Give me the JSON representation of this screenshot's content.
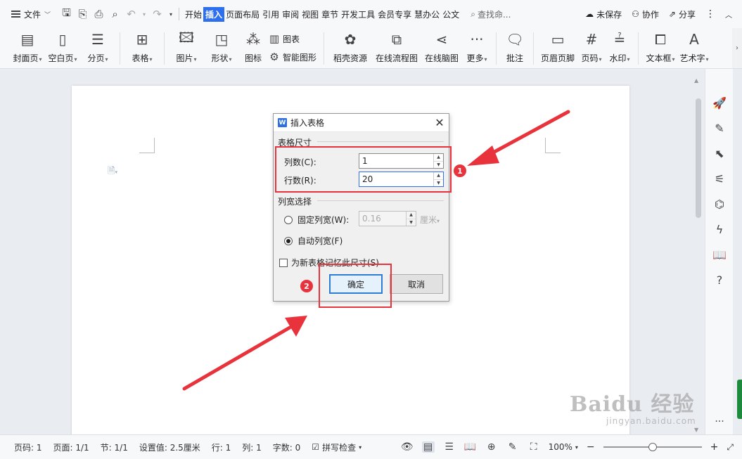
{
  "menubar": {
    "file_label": "文件",
    "tabs": [
      {
        "label": "开始",
        "active": false
      },
      {
        "label": "插入",
        "active": true
      },
      {
        "label": "页面布局",
        "active": false
      },
      {
        "label": "引用",
        "active": false
      },
      {
        "label": "审阅",
        "active": false
      },
      {
        "label": "视图",
        "active": false
      },
      {
        "label": "章节",
        "active": false
      },
      {
        "label": "开发工具",
        "active": false
      },
      {
        "label": "会员专享",
        "active": false
      },
      {
        "label": "慧办公",
        "active": false
      },
      {
        "label": "公文",
        "active": false
      }
    ],
    "search_placeholder": "查找命...",
    "unsaved": "未保存",
    "collab": "协作",
    "share": "分享"
  },
  "ribbon": {
    "cover": "封面页",
    "blank": "空白页",
    "pagebreak": "分页",
    "table": "表格",
    "picture": "图片",
    "shape": "形状",
    "icon": "图标",
    "chart": "图表",
    "smartart": "智能图形",
    "resources": "稻壳资源",
    "flowchart": "在线流程图",
    "mindmap": "在线脑图",
    "more": "更多",
    "comment": "批注",
    "headerfooter": "页眉页脚",
    "pagenum": "页码",
    "watermark": "水印",
    "textbox": "文本框",
    "wordart": "艺术字"
  },
  "dialog": {
    "title": "插入表格",
    "size_group": "表格尺寸",
    "cols_label": "列数(C):",
    "cols_value": "1",
    "rows_label": "行数(R):",
    "rows_value": "20",
    "width_group": "列宽选择",
    "fixed_label": "固定列宽(W):",
    "fixed_value": "0.16",
    "fixed_unit": "厘米",
    "auto_label": "自动列宽(F)",
    "remember_label": "为新表格记忆此尺寸(S)",
    "ok_label": "确定",
    "cancel_label": "取消"
  },
  "annotations": {
    "badge1": "1",
    "badge2": "2",
    "color": "#e8333c"
  },
  "statusbar": {
    "page": "页码: 1",
    "pages": "页面: 1/1",
    "section": "节: 1/1",
    "setting": "设置值: 2.5厘米",
    "row": "行: 1",
    "col": "列: 1",
    "words": "字数: 0",
    "spell": "拼写检查",
    "zoom": "100%",
    "zoom_level": 0.5
  },
  "watermark": {
    "brand": "Baidu 经验",
    "url": "jingyan.baidu.com"
  }
}
